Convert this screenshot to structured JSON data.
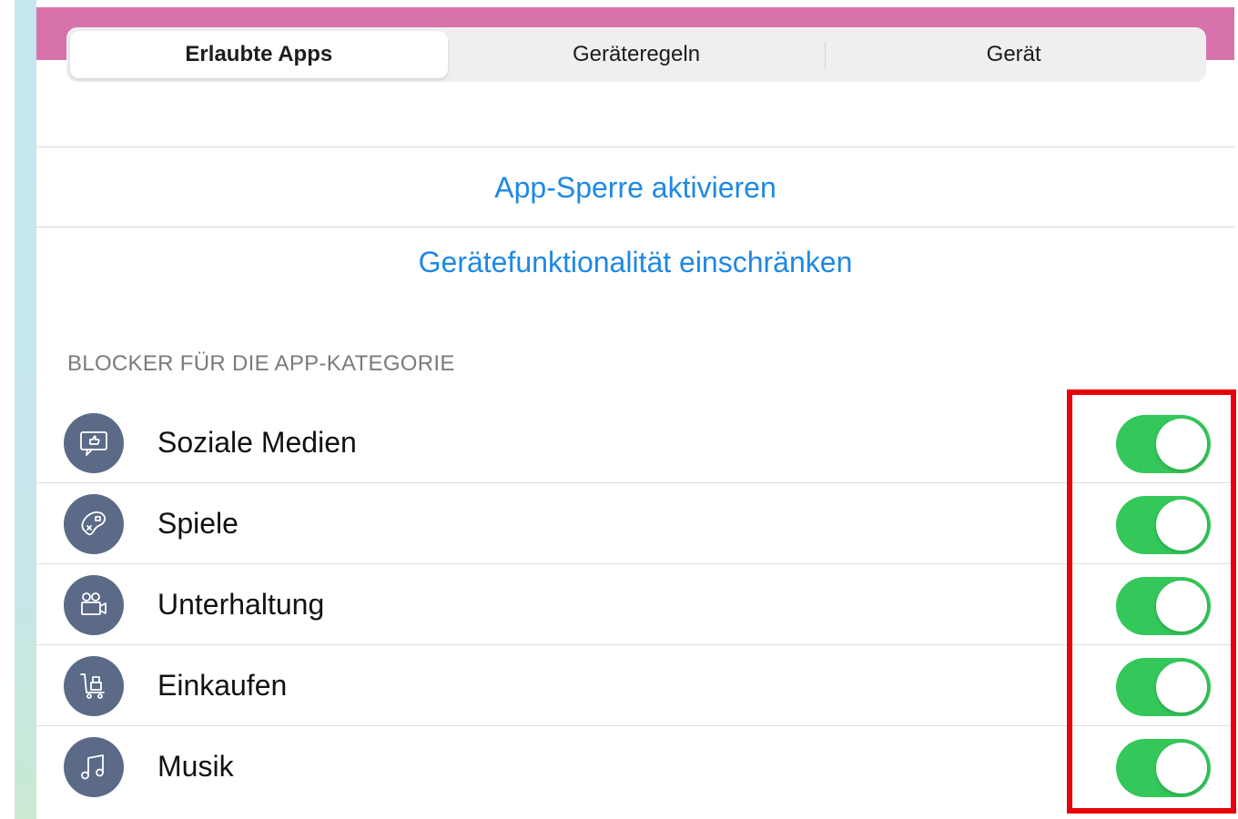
{
  "tabs": [
    {
      "label": "Erlaubte Apps",
      "active": true
    },
    {
      "label": "Geräteregeln",
      "active": false
    },
    {
      "label": "Gerät",
      "active": false
    }
  ],
  "links": {
    "app_lock": "App-Sperre aktivieren",
    "restrict": "Gerätefunktionalität einschränken"
  },
  "section": {
    "header": "BLOCKER FÜR DIE APP-KATEGORIE"
  },
  "categories": [
    {
      "label": "Soziale Medien",
      "icon": "social-media-icon",
      "enabled": true
    },
    {
      "label": "Spiele",
      "icon": "game-controller-icon",
      "enabled": true
    },
    {
      "label": "Unterhaltung",
      "icon": "video-camera-icon",
      "enabled": true
    },
    {
      "label": "Einkaufen",
      "icon": "shopping-cart-icon",
      "enabled": true
    },
    {
      "label": "Musik",
      "icon": "music-note-icon",
      "enabled": true
    }
  ],
  "colors": {
    "header_band": "#d872ad",
    "link": "#1e88e5",
    "toggle_on": "#34c759",
    "icon_bg": "#5b6a87",
    "highlight": "#e8000b"
  }
}
